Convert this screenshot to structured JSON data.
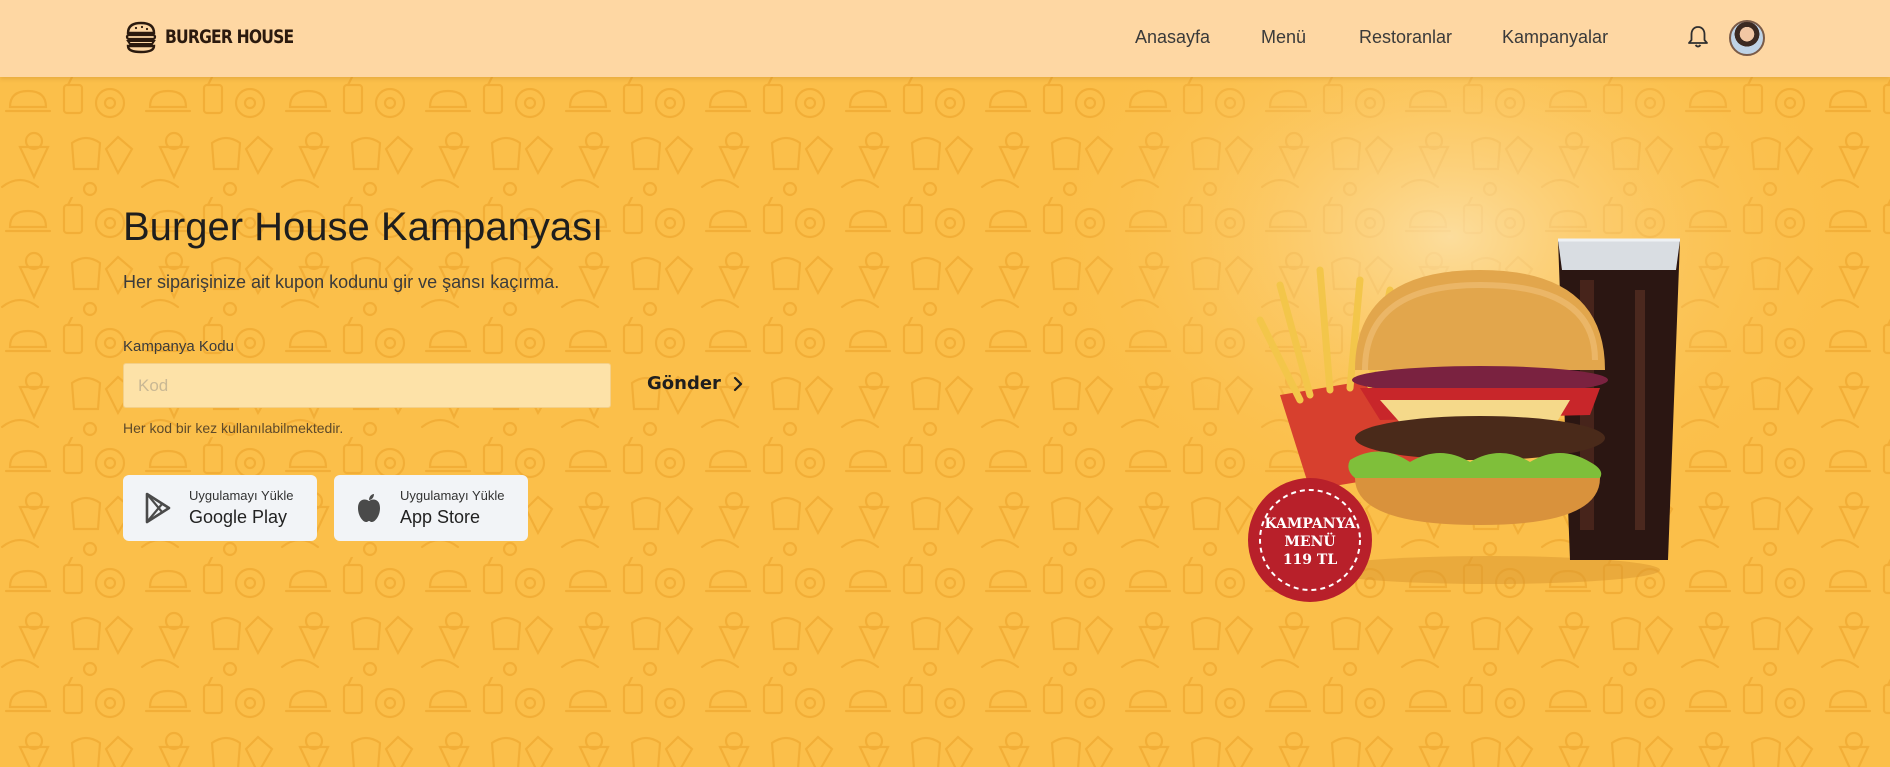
{
  "brand": {
    "name": "BURGER HOUSE",
    "logo_icon": "burger-icon"
  },
  "nav": {
    "items": [
      {
        "label": "Anasayfa"
      },
      {
        "label": "Menü"
      },
      {
        "label": "Restoranlar"
      },
      {
        "label": "Kampanyalar"
      }
    ]
  },
  "header_icons": {
    "notifications": "bell-icon",
    "profile": "avatar"
  },
  "hero": {
    "title": "Burger House Kampanyası",
    "subtitle": "Her siparişinize ait kupon kodunu gir ve şansı kaçırma.",
    "code_label": "Kampanya Kodu",
    "code_value": "",
    "code_placeholder": "Kod",
    "send_label": "Gönder",
    "hint": "Her kod bir kez kullanılabilmektedir."
  },
  "stores": [
    {
      "small": "Uygulamayı Yükle",
      "big": "Google Play",
      "icon": "google-play-icon"
    },
    {
      "small": "Uygulamayı Yükle",
      "big": "App Store",
      "icon": "apple-icon"
    }
  ],
  "promo_badge": {
    "line1": "KAMPANYA",
    "line2": "MENÜ",
    "line3": "119 TL"
  },
  "colors": {
    "header_bg": "#fed7a3",
    "hero_bg": "#fbbf4a",
    "badge_red": "#b8202a",
    "store_button_bg": "#f2f4f7"
  }
}
